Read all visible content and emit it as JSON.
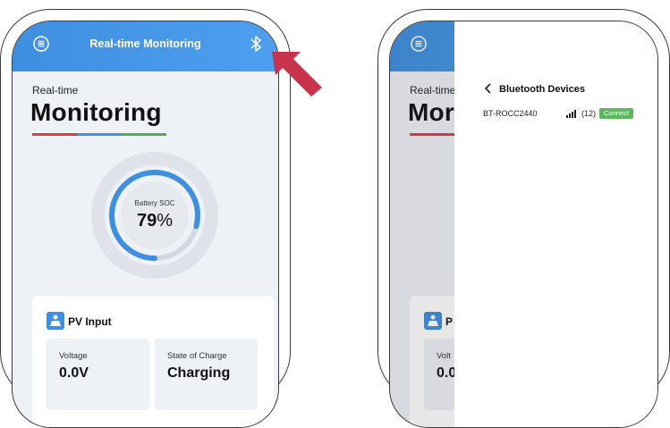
{
  "left_screen": {
    "appbar_title": "Real-time Monitoring",
    "heading_small": "Real-time",
    "heading_big": "Monitoring",
    "gauge": {
      "label": "Battery SOC",
      "value": "79",
      "unit": "%",
      "fraction": 0.79
    },
    "card": {
      "title": "PV Input",
      "tiles": [
        {
          "label": "Voltage",
          "value": "0.0V"
        },
        {
          "label": "State of Charge",
          "value": "Charging"
        }
      ]
    }
  },
  "right_screen": {
    "heading_small": "Real-time",
    "heading_big": "Mor",
    "card_title_partial": "P",
    "tile_label_partial": "Volt",
    "tile_value_partial": "0.0",
    "panel": {
      "title": "Bluetooth Devices",
      "devices": [
        {
          "name": "BT-ROCC2440",
          "signal": "(12)",
          "action": "Connect"
        }
      ]
    }
  },
  "colors": {
    "accent_blue": "#3f8fe0",
    "arrow_red": "#c8344c",
    "underline": [
      "#d84040",
      "#3f8fe0",
      "#4fae4f"
    ],
    "connect_green": "#5cb85c"
  }
}
